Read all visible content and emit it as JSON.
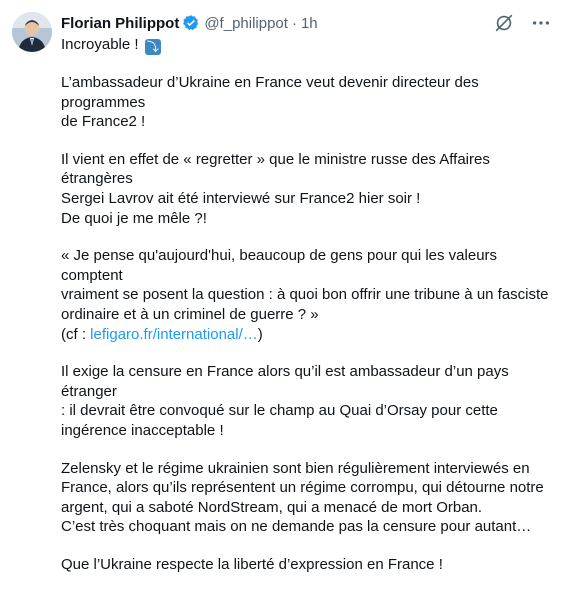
{
  "author": {
    "name": "Florian Philippot",
    "handle": "@f_philippot",
    "separator": "·",
    "time": "1h"
  },
  "tweet": {
    "first_line": "Incroyable !",
    "emoji": "⤵",
    "paragraphs": [
      [
        "L’ambassadeur d’Ukraine en France veut devenir directeur des programmes",
        "de France2 !"
      ],
      [
        "Il vient en effet de « regretter » que le ministre russe des Affaires étrangères",
        "Sergei Lavrov ait été interviewé sur France2 hier soir !",
        "De quoi je me mêle ?!"
      ],
      [
        "« Je pense qu'aujourd'hui, beaucoup de gens pour qui les valeurs comptent",
        "vraiment se posent la question : à quoi bon offrir une tribune à un fasciste",
        "ordinaire et à un criminel de guerre ? »"
      ],
      [
        "Il exige la censure en France alors qu’il est ambassadeur d’un pays étranger",
        ": il devrait être convoqué sur le champ au Quai d’Orsay pour cette",
        "ingérence inacceptable !"
      ],
      [
        "Zelensky et le régime ukrainien sont bien régulièrement interviewés en",
        "France, alors qu’ils représentent un régime corrompu, qui détourne notre",
        "argent, qui a saboté NordStream, qui a menacé de mort Orban.",
        "C’est très choquant mais on ne demande pas la censure pour autant…"
      ],
      [
        "Que l’Ukraine respecte la liberté d’expression en France !"
      ]
    ],
    "cite_prefix": "(cf : ",
    "cite_link": "lefigaro.fr/international/…",
    "cite_suffix": ")"
  },
  "icons": {
    "verified": "verified-badge-icon",
    "grok": "grok-icon",
    "more": "more-icon"
  },
  "colors": {
    "text": "#0f1419",
    "secondary": "#536471",
    "link": "#1d9bf0"
  }
}
